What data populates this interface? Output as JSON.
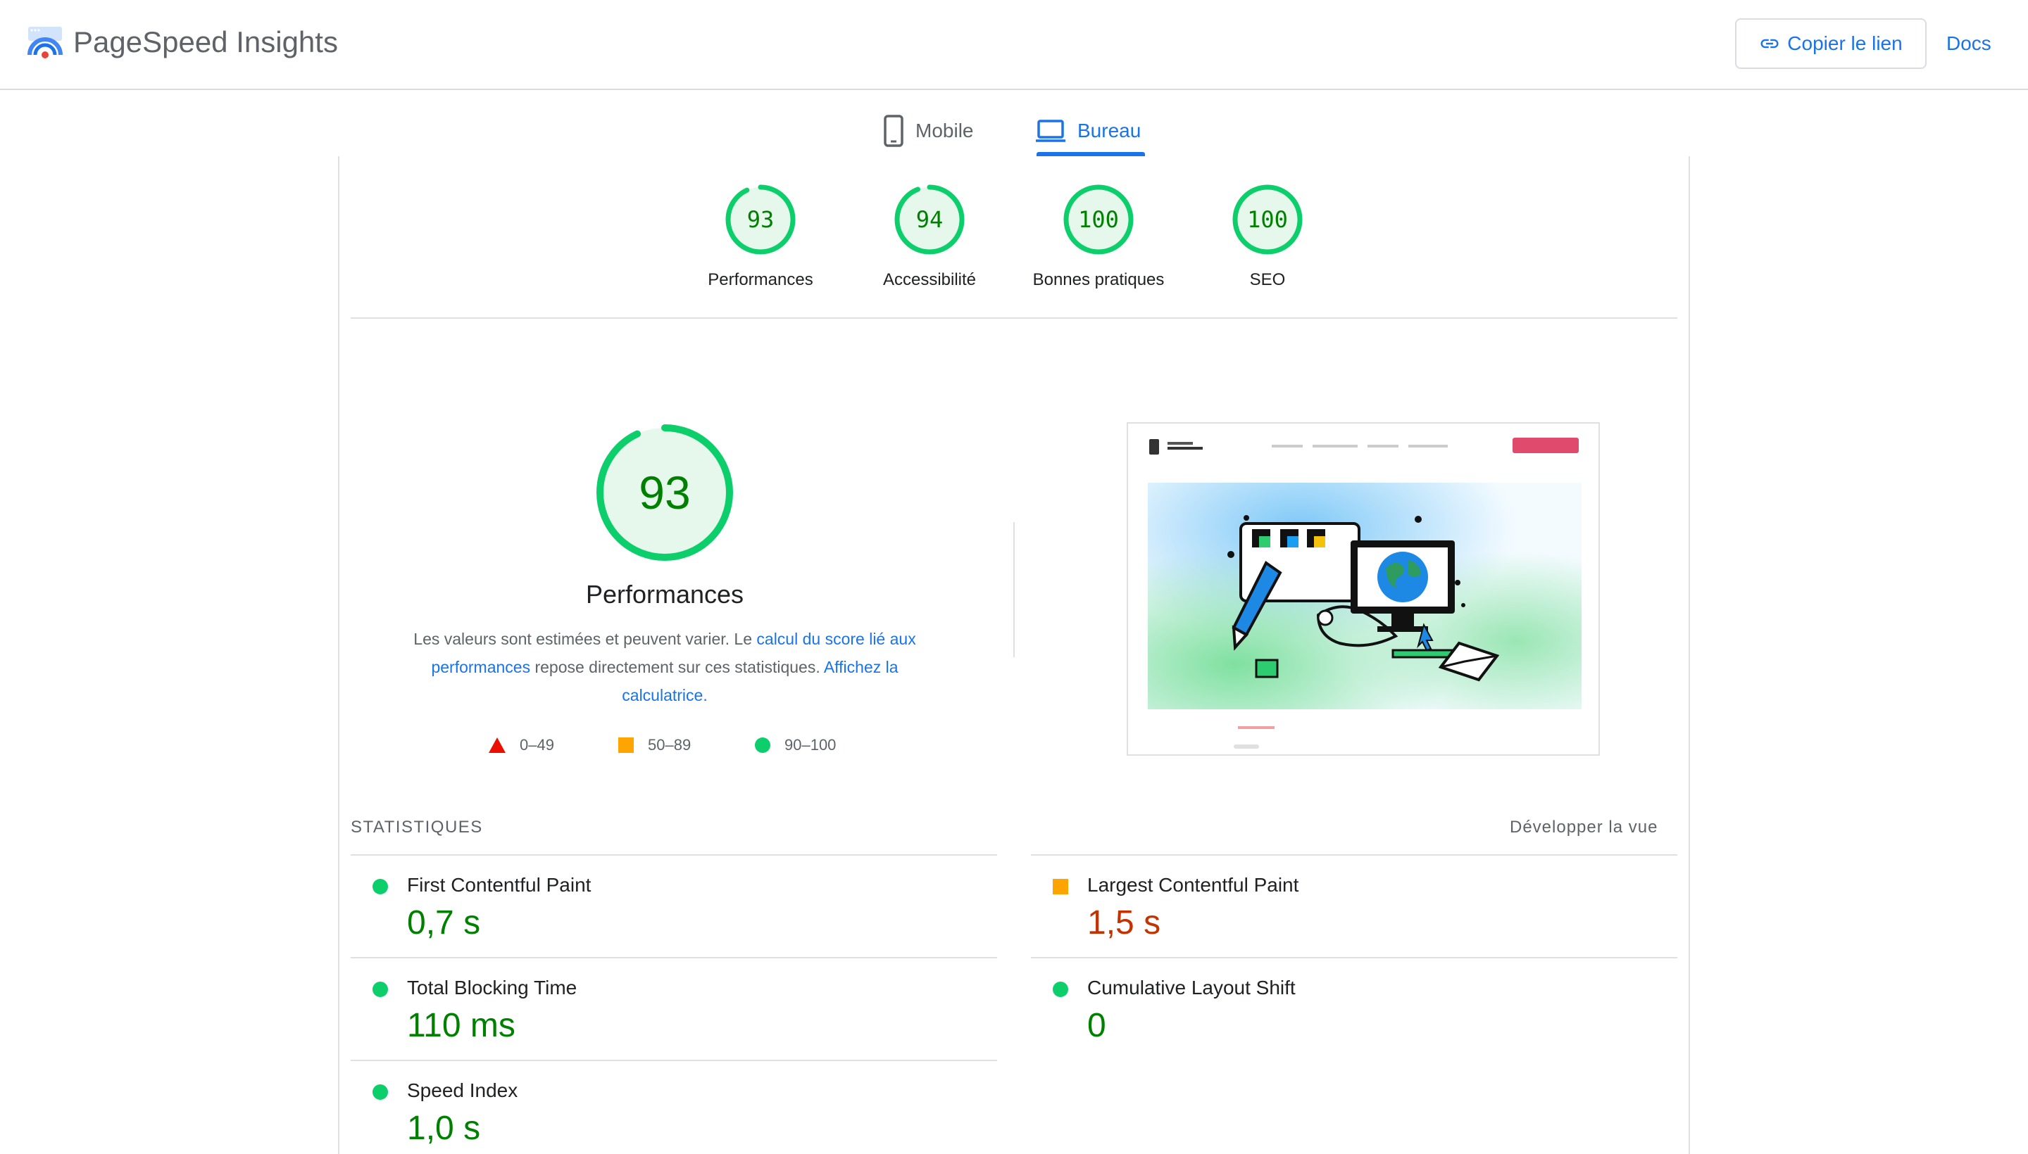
{
  "header": {
    "app_title": "PageSpeed Insights",
    "copy_link_label": "Copier le lien",
    "docs_label": "Docs"
  },
  "tabs": [
    {
      "label": "Mobile",
      "selected": false
    },
    {
      "label": "Bureau",
      "selected": true
    }
  ],
  "categories": [
    {
      "score": "93",
      "label": "Performances",
      "fraction": 0.93
    },
    {
      "score": "94",
      "label": "Accessibilité",
      "fraction": 0.94
    },
    {
      "score": "100",
      "label": "Bonnes pratiques",
      "fraction": 1.0
    },
    {
      "score": "100",
      "label": "SEO",
      "fraction": 1.0
    }
  ],
  "performance": {
    "score": "93",
    "fraction": 0.93,
    "title": "Performances",
    "desc_part1": "Les valeurs sont estimées et peuvent varier. Le ",
    "desc_link1": "calcul du score lié aux performances",
    "desc_part2": " repose directement sur ces statistiques. ",
    "desc_link2": "Affichez la calculatrice."
  },
  "legend": {
    "red": "0–49",
    "orange": "50–89",
    "green": "90–100"
  },
  "colors": {
    "pass": "#0cce6b",
    "average": "#ffa400",
    "fail": "#eb0f00",
    "accent": "#1a73e8"
  },
  "stats": {
    "title": "STATISTIQUES",
    "expand_label": "Développer la vue",
    "metrics": [
      {
        "label": "First Contentful Paint",
        "value": "0,7 s",
        "status": "pass"
      },
      {
        "label": "Largest Contentful Paint",
        "value": "1,5 s",
        "status": "average"
      },
      {
        "label": "Total Blocking Time",
        "value": "110 ms",
        "status": "pass"
      },
      {
        "label": "Cumulative Layout Shift",
        "value": "0",
        "status": "pass"
      },
      {
        "label": "Speed Index",
        "value": "1,0 s",
        "status": "pass"
      }
    ]
  }
}
